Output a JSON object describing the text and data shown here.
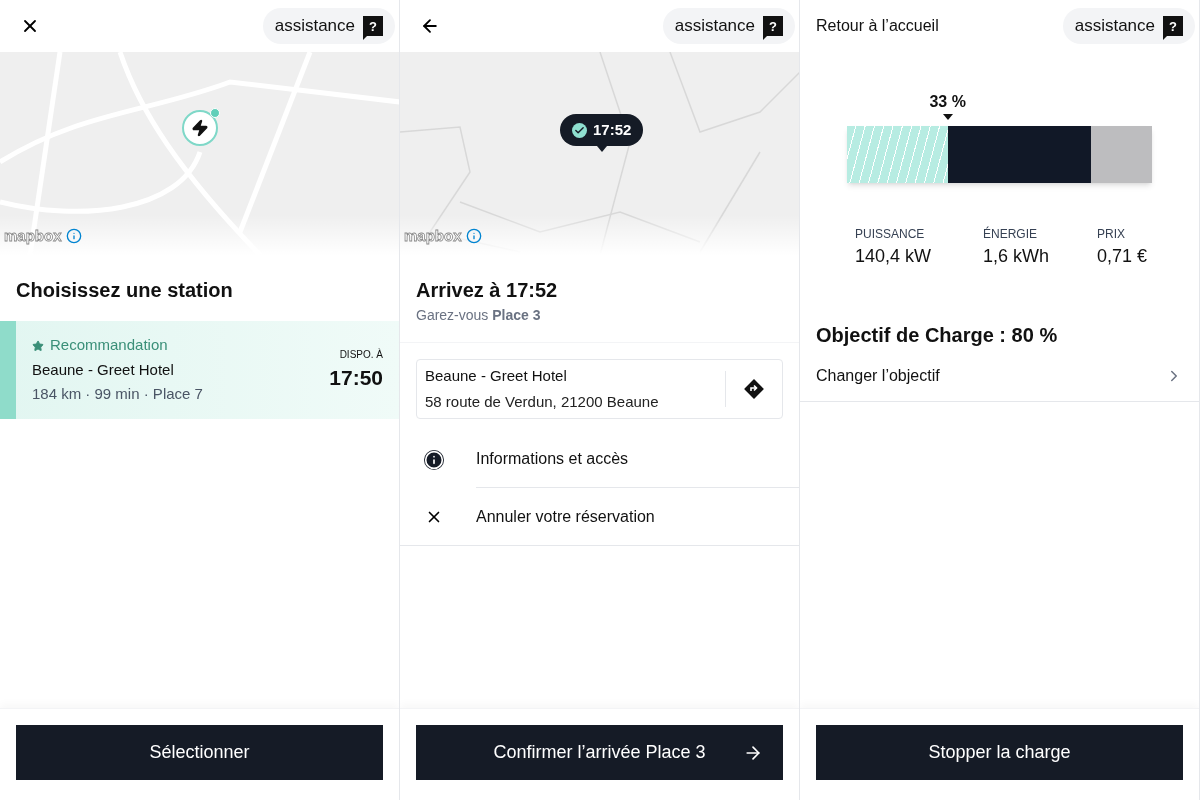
{
  "screens": [
    {
      "kind": "station_choice",
      "header": {
        "assistance": {
          "label": "assistance",
          "icon_char": "?"
        }
      },
      "map": {
        "kind": "station",
        "logo": "mapbox"
      },
      "title": "Choisissez une station",
      "stations": [
        {
          "selected": true,
          "tag": "Recommandation",
          "name": "Beaune - Greet Hotel",
          "details": "184 km · 99 min · Place 7",
          "availability_label": "DISPO. À",
          "time": "17:50"
        }
      ],
      "button": {
        "label": "Sélectionner"
      }
    },
    {
      "kind": "arrival",
      "header": {
        "assistance": {
          "label": "assistance",
          "icon_char": "?"
        }
      },
      "map": {
        "kind": "eta",
        "logo": "mapbox",
        "marker": "17:52"
      },
      "title": "Arrivez à 17:52",
      "subtitle": "Garez-vous **Place 3**",
      "address": {
        "name": "Beaune - Greet Hotel",
        "line": "58 route de Verdun, 21200 Beaune"
      },
      "actions": [
        {
          "kind": "info",
          "label": "Informations et accès"
        },
        {
          "kind": "cancel",
          "label": "Annuler votre réservation"
        }
      ],
      "button": {
        "label": "Confirmer l’arrivée Place 3"
      }
    },
    {
      "kind": "charging",
      "header": {
        "home_label": "Retour à l’accueil",
        "assistance": {
          "label": "assistance",
          "icon_char": "?"
        }
      },
      "charge": {
        "label": "33 %",
        "level": 0.33,
        "target": {
          "level": 0.8
        }
      },
      "stats": [
        {
          "label": "PUISSANCE",
          "value": "140,4 kW"
        },
        {
          "label": "ÉNERGIE",
          "value": "1,6 kWh"
        },
        {
          "label": "PRIX",
          "value": "0,71 €"
        }
      ],
      "title": "Objectif de Charge : 80 %",
      "setting": {
        "label": "Changer l’objectif"
      },
      "button": {
        "label": "Stopper la charge"
      }
    }
  ]
}
